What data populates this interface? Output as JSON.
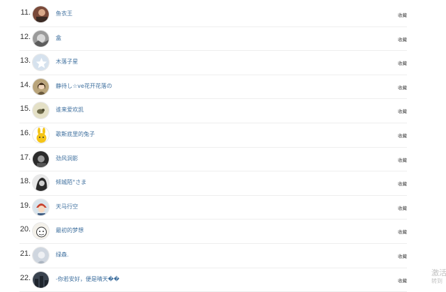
{
  "fans": [
    {
      "rank": "11.",
      "name": "鱼衣王",
      "action": "收藏",
      "avatar": "avatar-dark-portrait"
    },
    {
      "rank": "12.",
      "name": "盒",
      "action": "收藏",
      "avatar": "avatar-gray-landscape"
    },
    {
      "rank": "13.",
      "name": "木落子星",
      "action": "收藏",
      "avatar": "avatar-default-star-icon"
    },
    {
      "rank": "14.",
      "name": "静待し☆ve花开花落の",
      "action": "收藏",
      "avatar": "avatar-girl-portrait"
    },
    {
      "rank": "15.",
      "name": "谁来爱欢凯",
      "action": "收藏",
      "avatar": "avatar-light-bird"
    },
    {
      "rank": "16.",
      "name": "歌斯底里的兔子",
      "action": "收藏",
      "avatar": "avatar-yellow-rabbit"
    },
    {
      "rank": "17.",
      "name": "劲风洞影",
      "action": "收藏",
      "avatar": "avatar-dark-photo"
    },
    {
      "rank": "18.",
      "name": "倾城陌°さま",
      "action": "收藏",
      "avatar": "avatar-bw-girl"
    },
    {
      "rank": "19.",
      "name": "天马行空",
      "action": "收藏",
      "avatar": "avatar-anime-boy"
    },
    {
      "rank": "20.",
      "name": "最初的梦想",
      "action": "收藏",
      "avatar": "avatar-cartoon-face"
    },
    {
      "rank": "21.",
      "name": "绿森.",
      "action": "收藏",
      "avatar": "avatar-pale-portrait"
    },
    {
      "rank": "22.",
      "name": "-你若安好，便是晴天��",
      "action": "收藏",
      "avatar": "avatar-dark-city"
    }
  ],
  "watermark": {
    "line1": "激活",
    "line2": "转到"
  }
}
